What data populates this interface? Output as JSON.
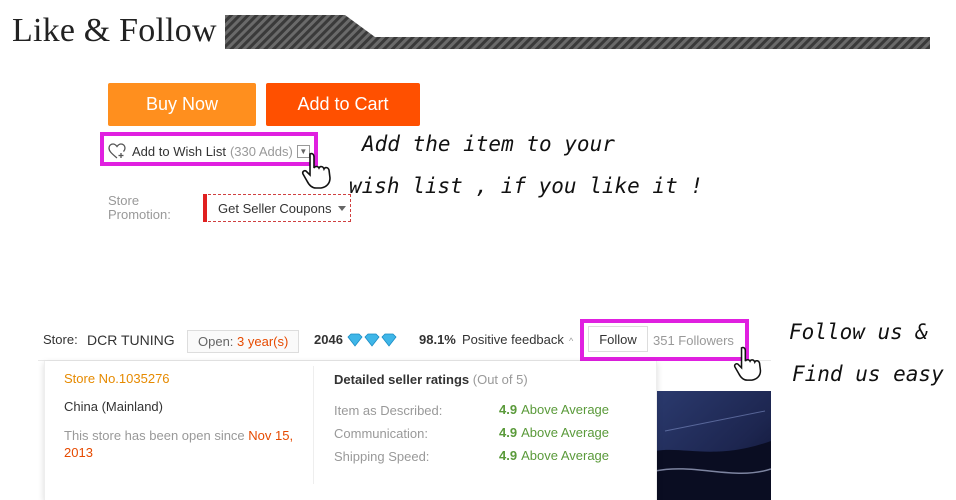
{
  "header": {
    "title": "Like & Follow"
  },
  "buttons": {
    "buy_now": "Buy Now",
    "add_to_cart": "Add to Cart"
  },
  "wishlist": {
    "label": "Add to Wish List",
    "count": "(330 Adds)"
  },
  "annotations": {
    "wish_line1": "Add the item to your",
    "wish_line2": "wish list , if you like it !",
    "follow_line1": "Follow us &",
    "follow_line2": "Find us easy"
  },
  "promotion": {
    "label": "Store Promotion:",
    "coupon": "Get Seller Coupons"
  },
  "store": {
    "label": "Store:",
    "name": "DCR TUNING",
    "open_prefix": "Open: ",
    "open_value": "3 year(s)",
    "score": "2046",
    "positive_pct": "98.1%",
    "positive_label": "Positive feedback",
    "follow": "Follow",
    "followers": "351 Followers"
  },
  "details": {
    "store_no": "Store No.1035276",
    "country": "China (Mainland)",
    "open_since_prefix": "This store has been open since ",
    "open_since_date": "Nov 15, 2013",
    "ratings_title": "Detailed seller ratings",
    "ratings_note": "(Out of 5)",
    "ratings": [
      {
        "label": "Item as Described:",
        "score": "4.9",
        "text": "Above Average"
      },
      {
        "label": "Communication:",
        "score": "4.9",
        "text": "Above Average"
      },
      {
        "label": "Shipping Speed:",
        "score": "4.9",
        "text": "Above Average"
      }
    ]
  },
  "colors": {
    "buy_now": "#ff8f1e",
    "add_to_cart": "#ff5000",
    "highlight": "#e020e0",
    "accent_red": "#e64a00",
    "rating_green": "#5a9a3a"
  },
  "icons": [
    "heart-plus-icon",
    "pointing-hand-icon",
    "diamond-icon",
    "chevron-down-icon"
  ]
}
